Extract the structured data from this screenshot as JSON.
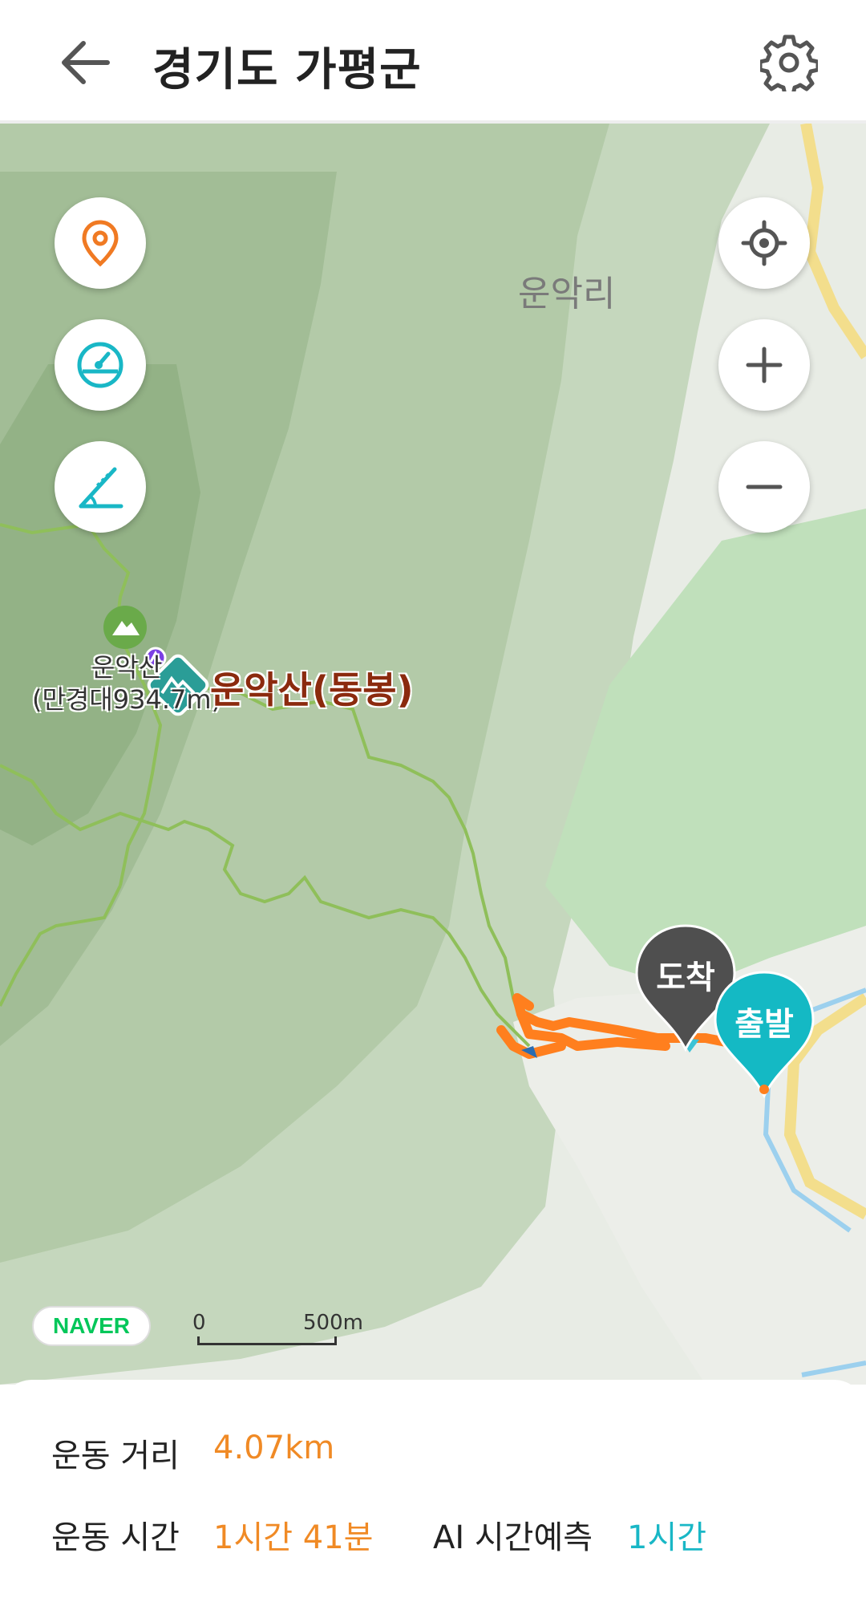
{
  "header": {
    "title": "경기도 가평군"
  },
  "map": {
    "place_label": "운악리",
    "peak_label": "운악산(동봉)",
    "peak2_line1": "운악산",
    "peak2_line2": "(만경대934.7m)",
    "arrival_label": "도착",
    "departure_label": "출발",
    "naver_logo": "NAVER",
    "scale_start": "0",
    "scale_end": "500m",
    "colors": {
      "track": "#ff7f1e",
      "arrival": "#4f4f4f",
      "departure": "#14b9c4",
      "trail": "#8fbf5a"
    }
  },
  "stats": {
    "distance_label": "운동 거리",
    "distance_value": "4.07km",
    "time_label": "운동 시간",
    "time_value": "1시간 41분",
    "ai_label": "AI 시간예측",
    "ai_value": "1시간",
    "colors": {
      "orange": "#f08a25",
      "teal": "#19b7c6"
    }
  }
}
